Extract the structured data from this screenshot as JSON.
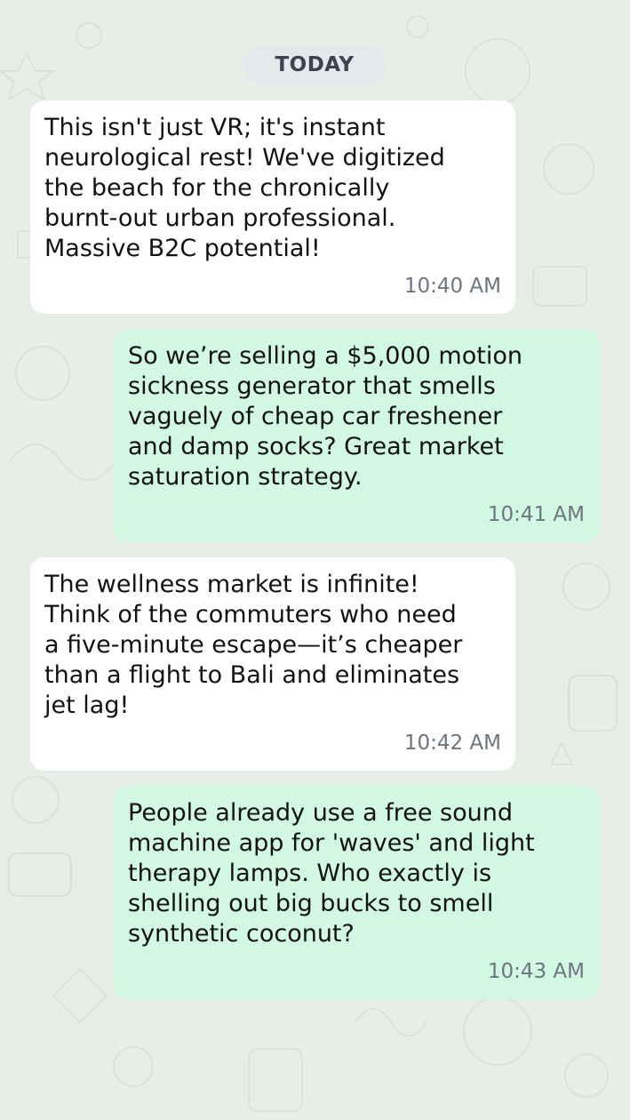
{
  "chat": {
    "date_divider": "TODAY",
    "messages": [
      {
        "direction": "incoming",
        "text": "This isn't just VR; it's instant\nneurological rest! We've digitized\nthe beach for the chronically\nburnt-out urban professional.\nMassive B2C potential!",
        "time": "10:40 AM"
      },
      {
        "direction": "outgoing",
        "text": "So we’re selling a $5,000 motion\nsickness generator that smells\nvaguely of cheap car freshener\nand damp socks? Great market\nsaturation strategy.",
        "time": "10:41 AM"
      },
      {
        "direction": "incoming",
        "text": "The wellness market is infinite!\nThink of the commuters who need\na five-minute escape—it’s cheaper\nthan a flight to Bali and eliminates\njet lag!",
        "time": "10:42 AM"
      },
      {
        "direction": "outgoing",
        "text": "People already use a free sound\nmachine app for 'waves' and light\ntherapy lamps. Who exactly is\nshelling out big bucks to smell\nsynthetic coconut?",
        "time": "10:43 AM"
      }
    ]
  },
  "colors": {
    "wallpaper": "#e7eee7",
    "incoming_bubble": "#ffffff",
    "outgoing_bubble": "#d2f7e2",
    "date_pill": "#e6e9ec",
    "timestamp": "#6d7580"
  }
}
